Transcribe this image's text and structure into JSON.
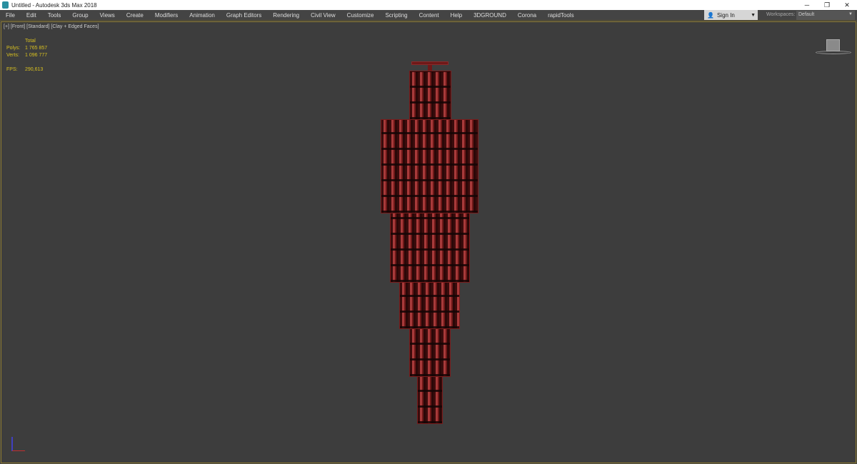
{
  "window": {
    "title": "Untitled - Autodesk 3ds Max 2018",
    "buttons": [
      "─",
      "❐",
      "✕"
    ]
  },
  "menu": [
    "File",
    "Edit",
    "Tools",
    "Group",
    "Views",
    "Create",
    "Modifiers",
    "Animation",
    "Graph Editors",
    "Rendering",
    "Civil View",
    "Customize",
    "Scripting",
    "Content",
    "Help",
    "3DGROUND",
    "Corona",
    "rapidTools"
  ],
  "account": {
    "sign_in": "Sign In",
    "caret": "▼"
  },
  "workspaces": {
    "label": "Workspaces:",
    "value": "Default",
    "caret": "▼"
  },
  "viewport": {
    "labels": [
      "[+]",
      "[Front]",
      "[Standard]",
      "[Clay + Edged Faces]"
    ]
  },
  "stats": {
    "header": "Total",
    "polys_label": "Polys:",
    "polys": "1 765 857",
    "verts_label": "Verts:",
    "verts": "1 096 777",
    "fps_label": "FPS:",
    "fps": "290,613"
  },
  "colors": {
    "model": "#a83a3a",
    "stats": "#d8c020",
    "viewport_border": "#8c7a2e"
  }
}
